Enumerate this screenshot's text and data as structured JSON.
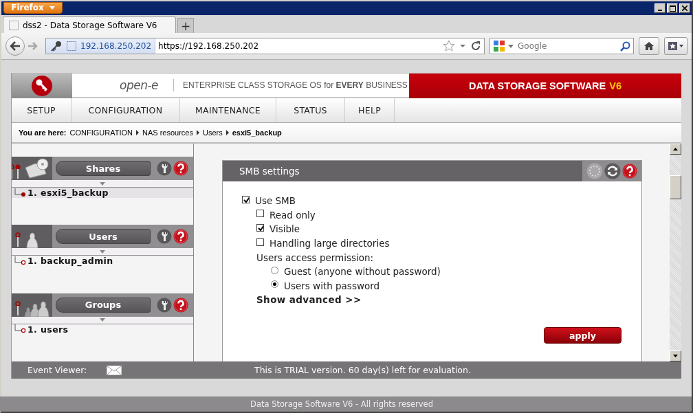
{
  "browser": {
    "menu_button": "Firefox",
    "tab": {
      "title": "dss2 - Data Storage Software V6"
    },
    "new_tab": "+",
    "site_identity": "192.168.250.202",
    "url": "https://192.168.250.202",
    "search": {
      "placeholder": "Google"
    }
  },
  "header": {
    "brand": "open-e",
    "tagline": "ENTERPRISE CLASS STORAGE OS for **EVERY** BUSINESS",
    "product": "DATA STORAGE SOFTWARE",
    "version": "V6"
  },
  "menu": [
    {
      "label": "SETUP"
    },
    {
      "label": "CONFIGURATION"
    },
    {
      "label": "MAINTENANCE"
    },
    {
      "label": "STATUS"
    },
    {
      "label": "HELP"
    }
  ],
  "breadcrumb": {
    "label": "You are here:",
    "items": [
      "CONFIGURATION",
      "NAS resources",
      "Users",
      "esxi5_backup"
    ]
  },
  "sidebar": [
    {
      "kind": "shares",
      "title": "Shares",
      "items": [
        {
          "label": "1. esxi5_backup",
          "selected": true
        }
      ]
    },
    {
      "kind": "users",
      "title": "Users",
      "items": [
        {
          "label": "1. backup_admin",
          "selected": false
        }
      ]
    },
    {
      "kind": "groups",
      "title": "Groups",
      "items": [
        {
          "label": "1. users",
          "selected": false
        }
      ]
    }
  ],
  "panel": {
    "title": "SMB settings",
    "options": [
      {
        "kind": "checkbox",
        "label": "Use SMB",
        "checked": true,
        "children": [
          {
            "kind": "checkbox",
            "label": "Read only",
            "checked": false
          },
          {
            "kind": "checkbox",
            "label": "Visible",
            "checked": true
          },
          {
            "kind": "checkbox",
            "label": "Handling large directories",
            "checked": false
          },
          {
            "kind": "heading",
            "label": "Users access permission:",
            "children": [
              {
                "kind": "radio",
                "label": "Guest (anyone without password)",
                "selected": false
              },
              {
                "kind": "radio",
                "label": "Users with password",
                "selected": true
              }
            ]
          },
          {
            "kind": "link",
            "label": "Show advanced >>"
          }
        ]
      }
    ],
    "apply": "apply"
  },
  "footer": {
    "event_viewer": "Event Viewer:",
    "trial": "This is TRIAL version. 60 day(s) left for evaluation.",
    "copyright": "Data Storage Software V6 - All rights reserved"
  }
}
